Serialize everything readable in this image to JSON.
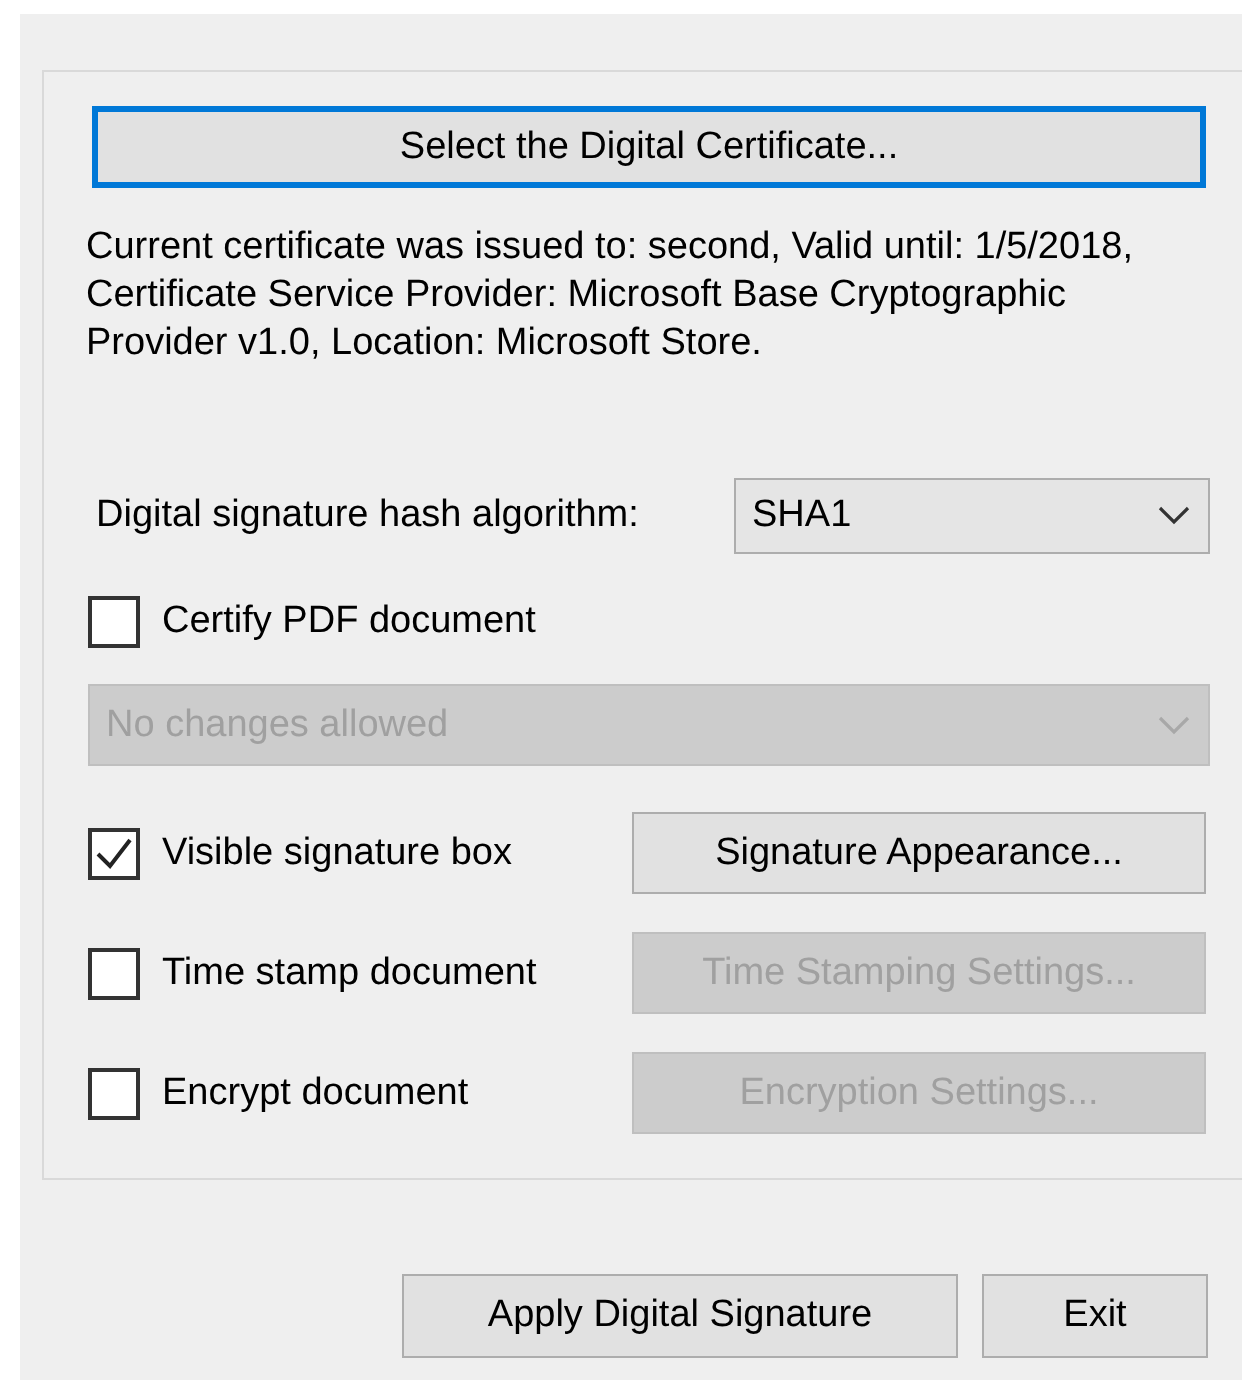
{
  "select_certificate_button": {
    "label": "Select the Digital Certificate...",
    "focused": true
  },
  "certificate_info": "Current certificate was issued to: second, Valid until: 1/5/2018, Certificate Service Provider: Microsoft Base Cryptographic Provider v1.0, Location: Microsoft Store.",
  "hash_algorithm": {
    "label": "Digital signature hash algorithm:",
    "value": "SHA1"
  },
  "options": [
    {
      "kind": "checkbox",
      "label": "Certify PDF document",
      "checked": false
    },
    {
      "kind": "dropdown",
      "value": "No changes allowed",
      "disabled": true
    },
    {
      "kind": "checkbox-button",
      "label": "Visible signature box",
      "checked": true,
      "button": {
        "label": "Signature Appearance...",
        "disabled": false
      }
    },
    {
      "kind": "checkbox-button",
      "label": "Time stamp document",
      "checked": false,
      "button": {
        "label": "Time Stamping Settings...",
        "disabled": true
      }
    },
    {
      "kind": "checkbox-button",
      "label": "Encrypt document",
      "checked": false,
      "button": {
        "label": "Encryption Settings...",
        "disabled": true
      }
    }
  ],
  "buttons": [
    {
      "label": "Apply Digital Signature"
    },
    {
      "label": "Exit"
    }
  ]
}
